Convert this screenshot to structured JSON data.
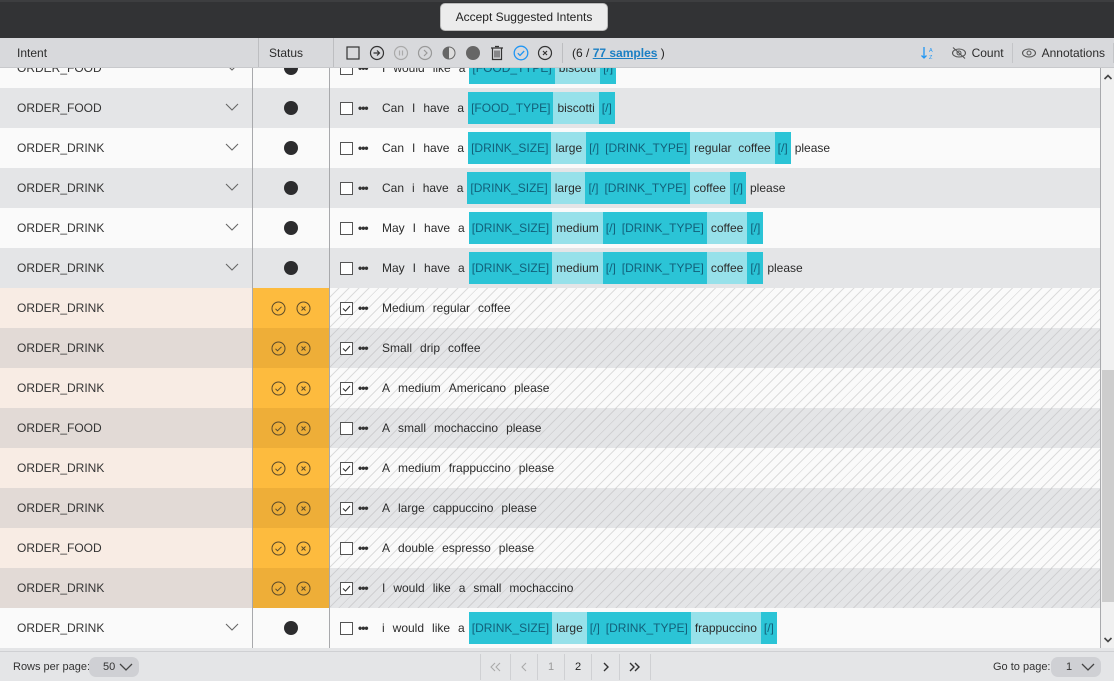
{
  "topbar": {
    "accept_button": "Accept Suggested Intents"
  },
  "header": {
    "intent_label": "Intent",
    "status_label": "Status",
    "selected_count": "6",
    "samples_link": "77 samples",
    "count_label": "Count",
    "annotations_label": "Annotations"
  },
  "toolbar_icons": [
    "select-all-checkbox",
    "go-to-icon",
    "pause-icon",
    "next-icon",
    "half-circle-icon",
    "filled-circle-icon",
    "trash-icon",
    "check-circle-icon",
    "close-circle-icon"
  ],
  "colors": {
    "tag_bg": "#2bc4d6",
    "value_bg": "#97e1ea",
    "suggested_status": "#fdbb3e",
    "accent_blue": "#2196f3"
  },
  "rows": [
    {
      "intent": "ORDER_FOOD",
      "kind": "normal",
      "checked": false,
      "tokens": [
        [
          "w",
          "I"
        ],
        [
          "w",
          "would"
        ],
        [
          "w",
          "like"
        ],
        [
          "w",
          "a"
        ],
        [
          "t",
          "[FOOD_TYPE]"
        ],
        [
          "v",
          "biscotti"
        ],
        [
          "t",
          "[/]"
        ]
      ]
    },
    {
      "intent": "ORDER_FOOD",
      "kind": "normal",
      "checked": false,
      "tokens": [
        [
          "w",
          "Can"
        ],
        [
          "w",
          "I"
        ],
        [
          "w",
          "have"
        ],
        [
          "w",
          "a"
        ],
        [
          "t",
          "[FOOD_TYPE]"
        ],
        [
          "v",
          "biscotti"
        ],
        [
          "t",
          "[/]"
        ]
      ]
    },
    {
      "intent": "ORDER_DRINK",
      "kind": "normal",
      "checked": false,
      "tokens": [
        [
          "w",
          "Can"
        ],
        [
          "w",
          "I"
        ],
        [
          "w",
          "have"
        ],
        [
          "w",
          "a"
        ],
        [
          "t",
          "[DRINK_SIZE]"
        ],
        [
          "v",
          "large"
        ],
        [
          "t",
          "[/]"
        ],
        [
          "t",
          "[DRINK_TYPE]"
        ],
        [
          "v",
          "regular  coffee"
        ],
        [
          "t",
          "[/]"
        ],
        [
          "w",
          "please"
        ]
      ]
    },
    {
      "intent": "ORDER_DRINK",
      "kind": "normal",
      "checked": false,
      "tokens": [
        [
          "w",
          "Can"
        ],
        [
          "w",
          "i"
        ],
        [
          "w",
          "have"
        ],
        [
          "w",
          "a"
        ],
        [
          "t",
          "[DRINK_SIZE]"
        ],
        [
          "v",
          "large"
        ],
        [
          "t",
          "[/]"
        ],
        [
          "t",
          "[DRINK_TYPE]"
        ],
        [
          "v",
          "coffee"
        ],
        [
          "t",
          "[/]"
        ],
        [
          "w",
          "please"
        ]
      ]
    },
    {
      "intent": "ORDER_DRINK",
      "kind": "normal",
      "checked": false,
      "tokens": [
        [
          "w",
          "May"
        ],
        [
          "w",
          "I"
        ],
        [
          "w",
          "have"
        ],
        [
          "w",
          "a"
        ],
        [
          "t",
          "[DRINK_SIZE]"
        ],
        [
          "v",
          "medium"
        ],
        [
          "t",
          "[/]"
        ],
        [
          "t",
          "[DRINK_TYPE]"
        ],
        [
          "v",
          "coffee"
        ],
        [
          "t",
          "[/]"
        ]
      ]
    },
    {
      "intent": "ORDER_DRINK",
      "kind": "normal",
      "checked": false,
      "tokens": [
        [
          "w",
          "May"
        ],
        [
          "w",
          "I"
        ],
        [
          "w",
          "have"
        ],
        [
          "w",
          "a"
        ],
        [
          "t",
          "[DRINK_SIZE]"
        ],
        [
          "v",
          "medium"
        ],
        [
          "t",
          "[/]"
        ],
        [
          "t",
          "[DRINK_TYPE]"
        ],
        [
          "v",
          "coffee"
        ],
        [
          "t",
          "[/]"
        ],
        [
          "w",
          "please"
        ]
      ]
    },
    {
      "intent": "ORDER_DRINK",
      "kind": "suggested",
      "checked": true,
      "tokens": [
        [
          "w",
          "Medium"
        ],
        [
          "w",
          "regular"
        ],
        [
          "w",
          "coffee"
        ]
      ]
    },
    {
      "intent": "ORDER_DRINK",
      "kind": "suggested",
      "checked": true,
      "tokens": [
        [
          "w",
          "Small"
        ],
        [
          "w",
          "drip"
        ],
        [
          "w",
          "coffee"
        ]
      ]
    },
    {
      "intent": "ORDER_DRINK",
      "kind": "suggested",
      "checked": true,
      "tokens": [
        [
          "w",
          "A"
        ],
        [
          "w",
          "medium"
        ],
        [
          "w",
          "Americano"
        ],
        [
          "w",
          "please"
        ]
      ]
    },
    {
      "intent": "ORDER_FOOD",
      "kind": "suggested",
      "checked": false,
      "tokens": [
        [
          "w",
          "A"
        ],
        [
          "w",
          "small"
        ],
        [
          "w",
          "mochaccino"
        ],
        [
          "w",
          "please"
        ]
      ]
    },
    {
      "intent": "ORDER_DRINK",
      "kind": "suggested",
      "checked": true,
      "tokens": [
        [
          "w",
          "A"
        ],
        [
          "w",
          "medium"
        ],
        [
          "w",
          "frappuccino"
        ],
        [
          "w",
          "please"
        ]
      ]
    },
    {
      "intent": "ORDER_DRINK",
      "kind": "suggested",
      "checked": true,
      "tokens": [
        [
          "w",
          "A"
        ],
        [
          "w",
          "large"
        ],
        [
          "w",
          "cappuccino"
        ],
        [
          "w",
          "please"
        ]
      ]
    },
    {
      "intent": "ORDER_FOOD",
      "kind": "suggested",
      "checked": false,
      "tokens": [
        [
          "w",
          "A"
        ],
        [
          "w",
          "double"
        ],
        [
          "w",
          "espresso"
        ],
        [
          "w",
          "please"
        ]
      ]
    },
    {
      "intent": "ORDER_DRINK",
      "kind": "suggested",
      "checked": true,
      "tokens": [
        [
          "w",
          "I"
        ],
        [
          "w",
          "would"
        ],
        [
          "w",
          "like"
        ],
        [
          "w",
          "a"
        ],
        [
          "w",
          "small"
        ],
        [
          "w",
          "mochaccino"
        ]
      ]
    },
    {
      "intent": "ORDER_DRINK",
      "kind": "normal",
      "checked": false,
      "tokens": [
        [
          "w",
          "i"
        ],
        [
          "w",
          "would"
        ],
        [
          "w",
          "like"
        ],
        [
          "w",
          "a"
        ],
        [
          "t",
          "[DRINK_SIZE]"
        ],
        [
          "v",
          "large"
        ],
        [
          "t",
          "[/]"
        ],
        [
          "t",
          "[DRINK_TYPE]"
        ],
        [
          "v",
          "frappuccino"
        ],
        [
          "t",
          "[/]"
        ]
      ]
    }
  ],
  "footer": {
    "rows_per_page_label": "Rows per page:",
    "rows_per_page_value": "50",
    "pages": [
      "1",
      "2"
    ],
    "current_page": "2",
    "go_to_page_label": "Go to page:",
    "go_to_page_value": "1"
  }
}
